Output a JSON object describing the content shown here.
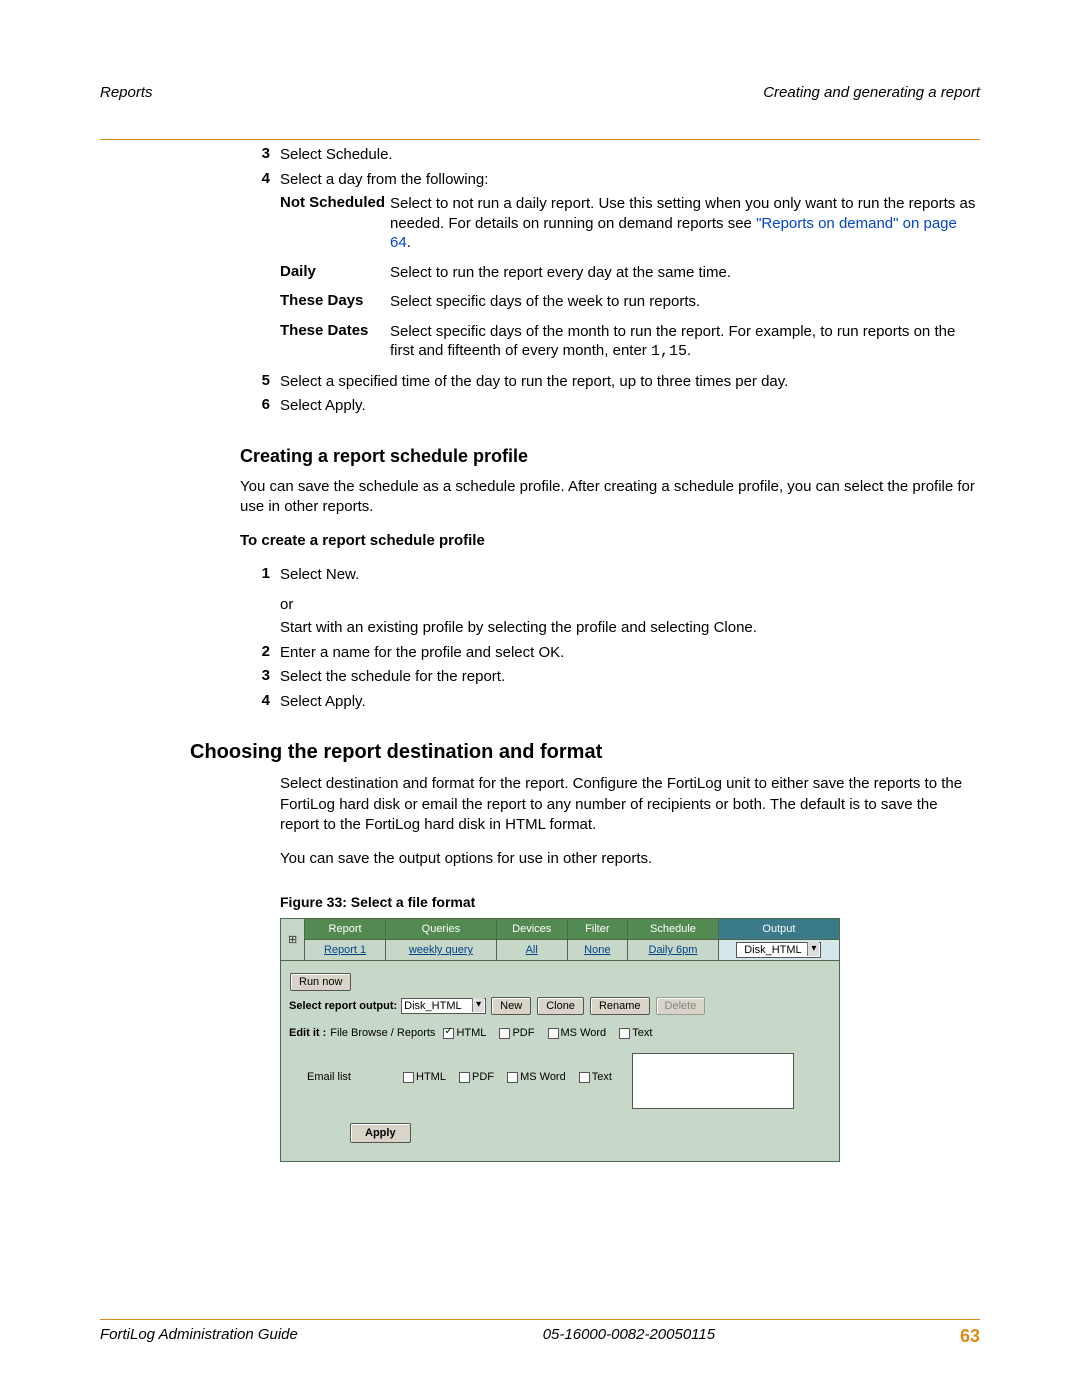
{
  "header": {
    "left": "Reports",
    "right": "Creating and generating a report"
  },
  "steps_top": {
    "s3": "Select Schedule.",
    "s4": "Select a day from the following:",
    "not_scheduled_label": "Not Scheduled",
    "not_scheduled_desc_a": "Select to not run a daily report. Use this setting when you only want to run the reports as needed. For details on running on demand reports see ",
    "not_scheduled_xref": "\"Reports on demand\" on page 64",
    "not_scheduled_desc_b": ".",
    "daily_label": "Daily",
    "daily_desc": "Select to run the report every day at the same time.",
    "these_days_label": "These Days",
    "these_days_desc": "Select specific days of the week to run reports.",
    "these_dates_label": "These Dates",
    "these_dates_desc_a": "Select specific days of the month to run the report. For example, to run reports on the first and fifteenth of every month, enter ",
    "these_dates_code": "1,15",
    "these_dates_desc_b": ".",
    "s5": "Select a specified time of the day to run the report, up to three times per day.",
    "s6": "Select Apply."
  },
  "sect1_title": "Creating a report schedule profile",
  "sect1_p1": "You can save the schedule as a schedule profile. After creating a schedule profile, you can select the profile for use in other reports.",
  "sect1_sub": "To create a report schedule profile",
  "sect1_steps": {
    "s1_a": "Select New.",
    "s1_or": "or",
    "s1_b": "Start with an existing profile by selecting the profile and selecting Clone.",
    "s2": "Enter a name for the profile and select OK.",
    "s3": "Select the schedule for the report.",
    "s4": "Select Apply."
  },
  "sect2_title": "Choosing the report destination and format",
  "sect2_p1": "Select destination and format for the report. Configure the FortiLog unit to either save the reports to the FortiLog hard disk or email the report to any number of recipients or both. The default is to save the report to the FortiLog hard disk in HTML format.",
  "sect2_p2": "You can save the output options for use in other reports.",
  "fig_caption": "Figure 33: Select a file format",
  "ui": {
    "cols": {
      "report": "Report",
      "queries": "Queries",
      "devices": "Devices",
      "filter": "Filter",
      "schedule": "Schedule",
      "output": "Output"
    },
    "row": {
      "report": "Report 1",
      "queries": "weekly query",
      "devices": "All",
      "filter": "None",
      "schedule": "Daily 6pm",
      "output": "Disk_HTML"
    },
    "run_now": "Run now",
    "select_output_label": "Select report output:",
    "select_output_value": "Disk_HTML",
    "btn_new": "New",
    "btn_clone": "Clone",
    "btn_rename": "Rename",
    "btn_delete": "Delete",
    "edit_it": "Edit it :",
    "file_browse": "File Browse / Reports",
    "email_list": "Email list",
    "fmt_html": "HTML",
    "fmt_pdf": "PDF",
    "fmt_msword": "MS Word",
    "fmt_text": "Text",
    "apply": "Apply"
  },
  "footer": {
    "left": "FortiLog Administration Guide",
    "center": "05-16000-0082-20050115",
    "page": "63"
  }
}
